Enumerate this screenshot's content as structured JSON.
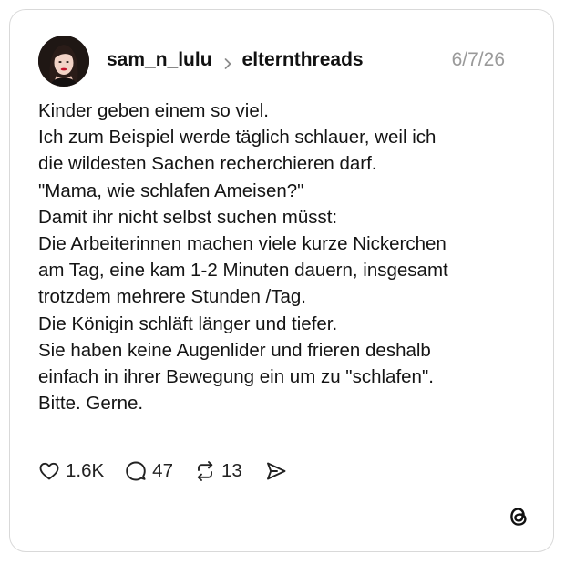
{
  "post": {
    "username": "sam_n_lulu",
    "community": "elternthreads",
    "date": "6/7/26",
    "lines": [
      "Kinder geben einem so viel.",
      "Ich zum Beispiel werde täglich schlauer, weil ich",
      "die wildesten Sachen recherchieren darf.",
      "\"Mama, wie schlafen Ameisen?\"",
      "Damit ihr nicht selbst suchen müsst:",
      "Die Arbeiterinnen machen viele kurze Nickerchen",
      "am Tag, eine kam 1-2 Minuten dauern, insgesamt",
      "trotzdem mehrere Stunden /Tag.",
      "Die Königin schläft länger und tiefer.",
      "Sie haben keine Augenlider und frieren deshalb",
      "einfach in ihrer Bewegung ein um zu \"schlafen\".",
      "Bitte. Gerne."
    ],
    "stats": {
      "likes": "1.6K",
      "replies": "47",
      "reposts": "13"
    }
  },
  "icons": {
    "separator": "chevron-right-icon",
    "like": "heart-icon",
    "reply": "comment-icon",
    "repost": "repost-icon",
    "share": "send-icon",
    "brand": "threads-logo-icon"
  },
  "colors": {
    "text": "#141414",
    "muted": "#9a9a9a",
    "border": "#d9d9d9",
    "background": "#ffffff"
  }
}
